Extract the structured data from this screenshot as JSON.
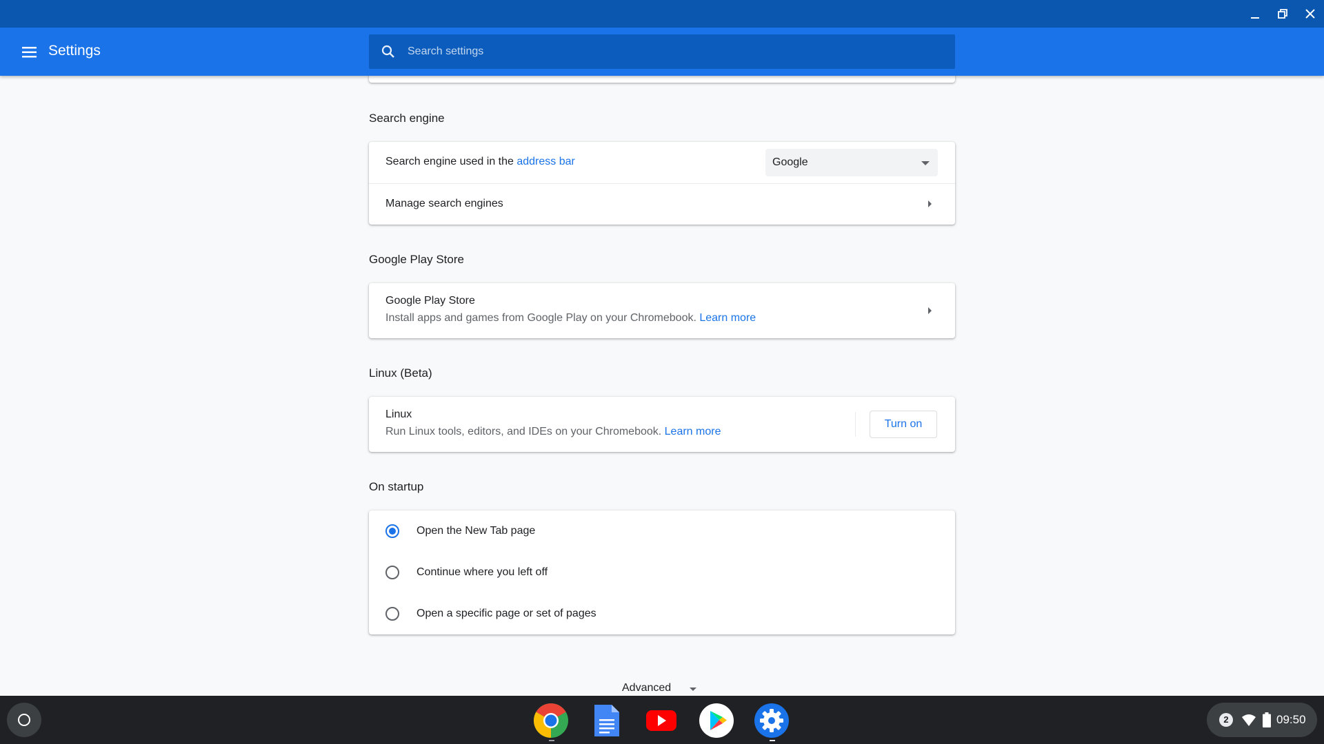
{
  "window": {
    "controls": [
      "minimize-icon",
      "restore-icon",
      "close-icon"
    ]
  },
  "header": {
    "title": "Settings",
    "search_placeholder": "Search settings"
  },
  "sections": {
    "search_engine": {
      "title": "Search engine",
      "engine_label_prefix": "Search engine used in the ",
      "engine_label_link": "address bar",
      "engine_value": "Google",
      "manage_label": "Manage search engines"
    },
    "play_store": {
      "title": "Google Play Store",
      "row_title": "Google Play Store",
      "row_sub": "Install apps and games from Google Play on your Chromebook. ",
      "learn_more": "Learn more"
    },
    "linux": {
      "title": "Linux (Beta)",
      "row_title": "Linux",
      "row_sub": "Run Linux tools, editors, and IDEs on your Chromebook. ",
      "learn_more": "Learn more",
      "button": "Turn on"
    },
    "startup": {
      "title": "On startup",
      "options": [
        {
          "label": "Open the New Tab page",
          "checked": true
        },
        {
          "label": "Continue where you left off",
          "checked": false
        },
        {
          "label": "Open a specific page or set of pages",
          "checked": false
        }
      ]
    }
  },
  "advanced": "Advanced",
  "shelf": {
    "apps": [
      "chrome-icon",
      "docs-icon",
      "youtube-icon",
      "play-store-icon",
      "settings-icon"
    ],
    "notification_count": "2",
    "time": "09:50"
  },
  "colors": {
    "caption": "#0b57b0",
    "header": "#1a73e8",
    "accent": "#1a73e8",
    "shelf": "#202124"
  }
}
